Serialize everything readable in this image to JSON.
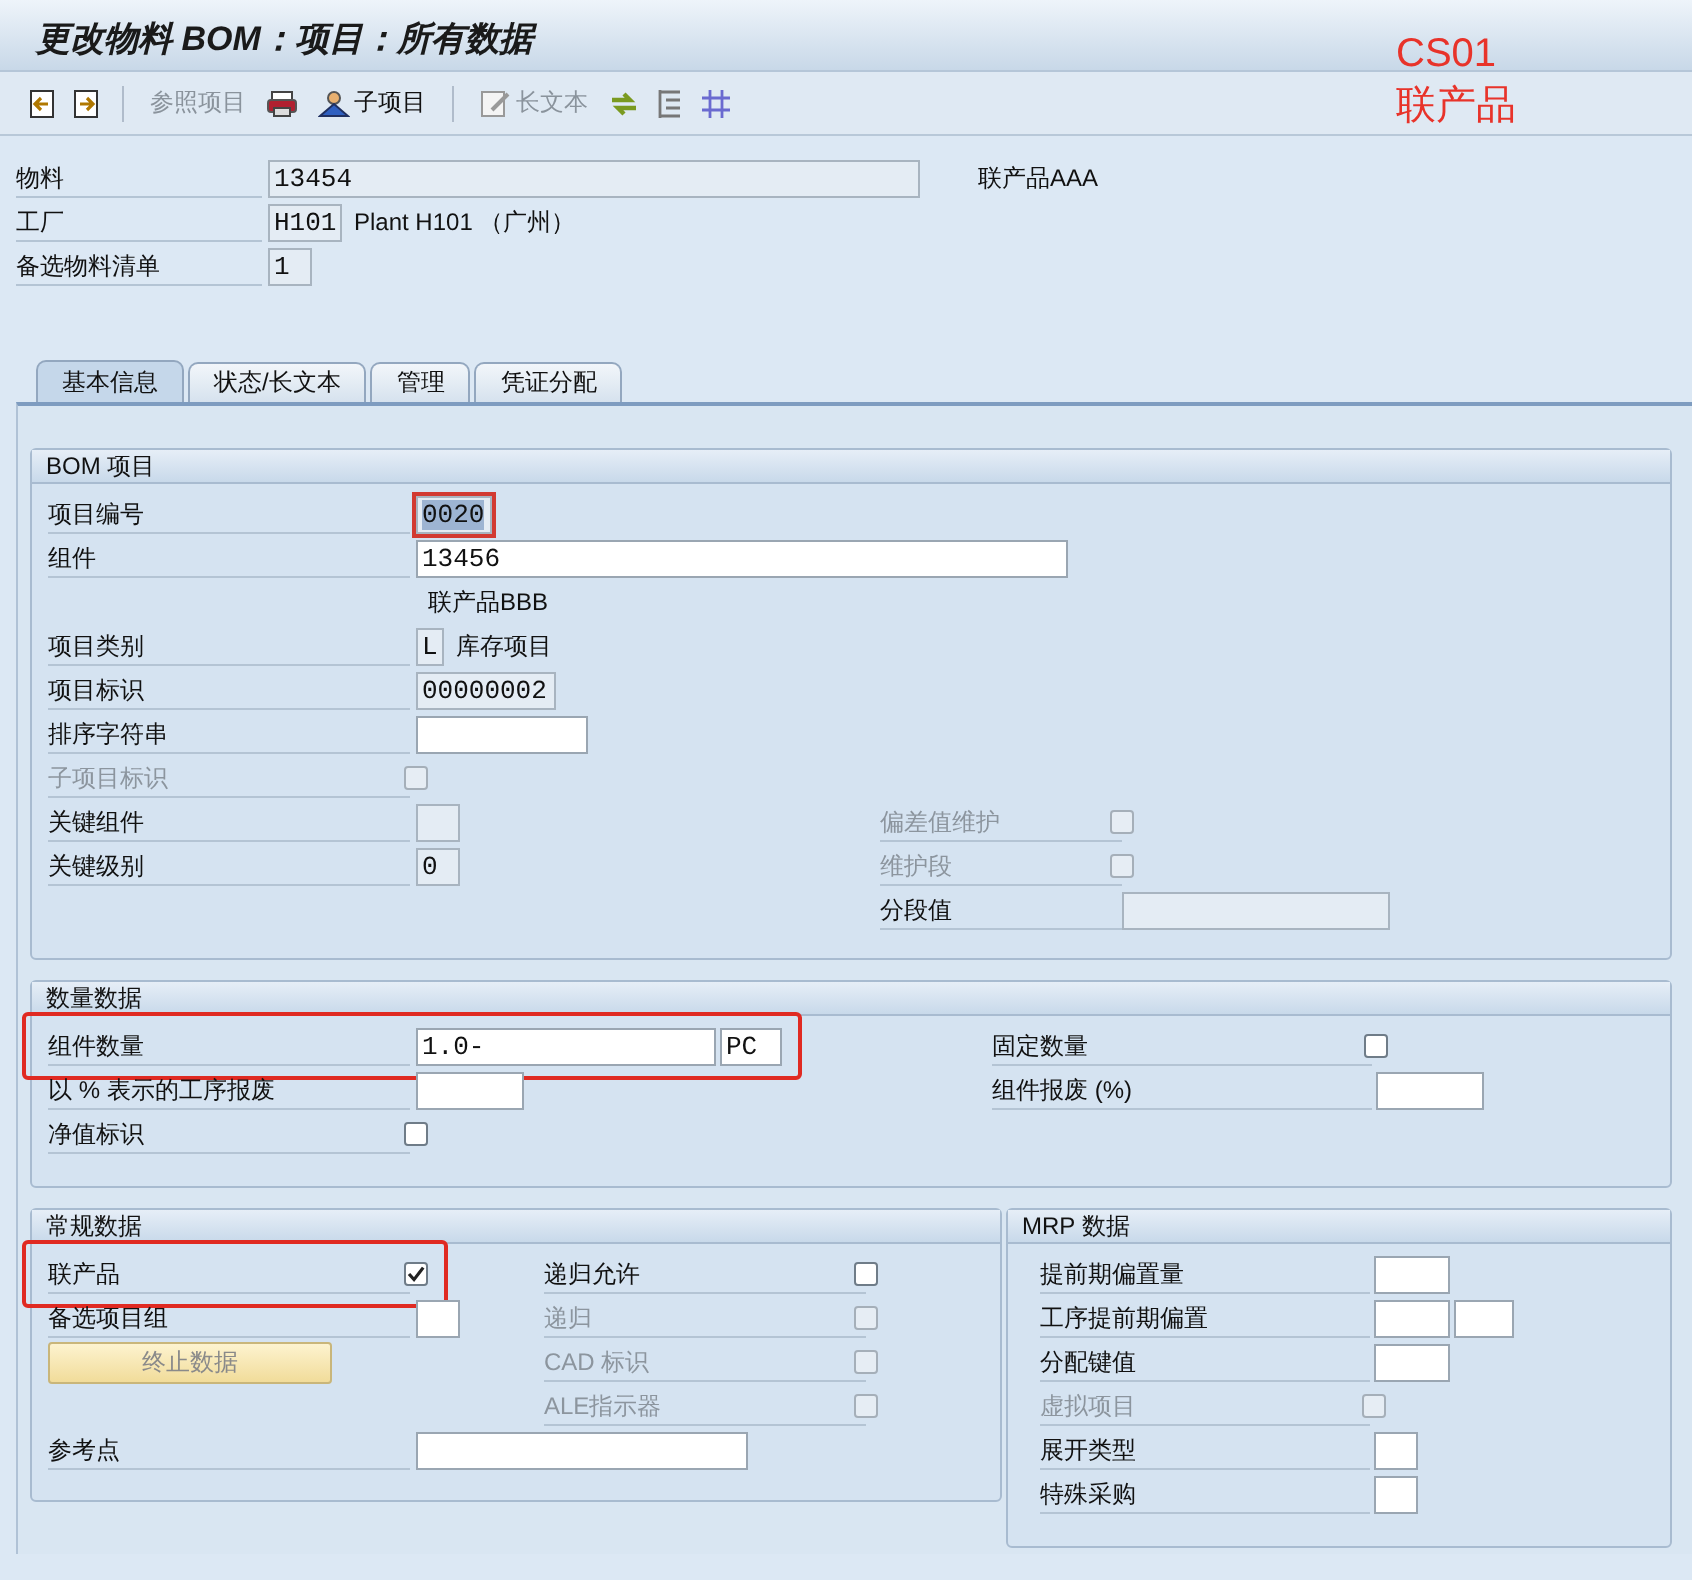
{
  "window": {
    "title": "更改物料 BOM：项目：所有数据"
  },
  "annotation": {
    "lines": [
      "CS01",
      "联产品"
    ]
  },
  "toolbar": [
    {
      "label": "参照项目",
      "disabled": true
    },
    {
      "label": "子项目",
      "disabled": false
    },
    {
      "label": "长文本",
      "disabled": true
    }
  ],
  "header_fields": [
    {
      "label": "物料",
      "controls": [
        {
          "kind": "field",
          "value": "13454",
          "disabled": true
        },
        {
          "kind": "text",
          "text": "联产品AAA"
        }
      ]
    },
    {
      "label": "工厂",
      "controls": [
        {
          "kind": "field",
          "value": "H101",
          "disabled": true
        },
        {
          "kind": "text",
          "text": "Plant H101 （广州）"
        }
      ]
    },
    {
      "label": "备选物料清单",
      "controls": [
        {
          "kind": "field",
          "value": "1",
          "disabled": true
        }
      ]
    }
  ],
  "tabs": [
    {
      "label": "基本信息",
      "selected": true
    },
    {
      "label": "状态/长文本",
      "selected": false
    },
    {
      "label": "管理",
      "selected": false
    },
    {
      "label": "凭证分配",
      "selected": false
    }
  ],
  "groups": [
    {
      "title": "BOM 项目",
      "rows": [
        {
          "left": {
            "label": "项目编号",
            "disabled": false,
            "controls": [
              {
                "kind": "field",
                "value": "0020",
                "disabled": true,
                "focused": true
              }
            ]
          }
        },
        {
          "left": {
            "label": "组件",
            "disabled": false,
            "controls": [
              {
                "kind": "field",
                "value": "13456",
                "disabled": false,
                "focused": false
              }
            ]
          }
        },
        {
          "left": {
            "controls": [
              {
                "kind": "text",
                "text": "联产品BBB"
              }
            ]
          }
        },
        {
          "left": {
            "label": "项目类别",
            "disabled": false,
            "controls": [
              {
                "kind": "field",
                "value": "L",
                "disabled": true,
                "focused": false
              },
              {
                "kind": "text",
                "text": "库存项目"
              }
            ]
          }
        },
        {
          "left": {
            "label": "项目标识",
            "disabled": false,
            "controls": [
              {
                "kind": "field",
                "value": "00000002",
                "disabled": true,
                "focused": false
              }
            ]
          }
        },
        {
          "left": {
            "label": "排序字符串",
            "disabled": false,
            "controls": [
              {
                "kind": "field",
                "disabled": false,
                "focused": false
              }
            ]
          }
        },
        {
          "left": {
            "label": "子项目标识",
            "disabled": true,
            "controls": [
              {
                "kind": "checkbox",
                "checked": false,
                "disabled": true
              }
            ]
          }
        },
        {
          "left": {
            "label": "关键组件",
            "disabled": false,
            "controls": [
              {
                "kind": "field",
                "disabled": true,
                "focused": false
              }
            ]
          },
          "right": {
            "label": "偏差值维护",
            "disabled": true,
            "controls": [
              {
                "kind": "checkbox",
                "checked": false,
                "disabled": true
              }
            ]
          }
        },
        {
          "left": {
            "label": "关键级别",
            "disabled": false,
            "controls": [
              {
                "kind": "field",
                "value": "0",
                "disabled": true,
                "focused": false
              }
            ]
          },
          "right": {
            "label": "维护段",
            "disabled": true,
            "controls": [
              {
                "kind": "checkbox",
                "checked": false,
                "disabled": true
              }
            ]
          }
        },
        {
          "right": {
            "label": "分段值",
            "disabled": false,
            "controls": [
              {
                "kind": "field",
                "disabled": true,
                "focused": false
              }
            ]
          }
        }
      ]
    },
    {
      "title": "数量数据",
      "rows": [
        {
          "left": {
            "label": "组件数量",
            "disabled": false,
            "highlighted": true,
            "controls": [
              {
                "kind": "field",
                "value": "1.0-",
                "disabled": false,
                "focused": false
              },
              {
                "kind": "field",
                "value": "PC",
                "disabled": false,
                "focused": false
              }
            ]
          },
          "right": {
            "label": "固定数量",
            "disabled": false,
            "controls": [
              {
                "kind": "checkbox",
                "checked": false,
                "disabled": false
              }
            ]
          }
        },
        {
          "left": {
            "label": "以 % 表示的工序报废",
            "disabled": false,
            "controls": [
              {
                "kind": "field",
                "disabled": false,
                "focused": false
              }
            ]
          },
          "right": {
            "label": "组件报废 (%)",
            "disabled": false,
            "controls": [
              {
                "kind": "field",
                "disabled": false,
                "focused": false
              }
            ]
          }
        },
        {
          "left": {
            "label": "净值标识",
            "disabled": false,
            "controls": [
              {
                "kind": "checkbox",
                "checked": false,
                "disabled": false
              }
            ]
          }
        }
      ]
    },
    {
      "title": "常规数据",
      "rows": [
        {
          "left": {
            "label": "联产品",
            "disabled": false,
            "highlighted": true,
            "controls": [
              {
                "kind": "checkbox",
                "checked": true,
                "disabled": false
              }
            ]
          },
          "right": {
            "label": "递归允许",
            "disabled": false,
            "controls": [
              {
                "kind": "checkbox",
                "checked": false,
                "disabled": false
              }
            ]
          }
        },
        {
          "left": {
            "label": "备选项目组",
            "disabled": false,
            "controls": [
              {
                "kind": "field",
                "disabled": false,
                "focused": false
              }
            ]
          },
          "right": {
            "label": "递归",
            "disabled": true,
            "controls": [
              {
                "kind": "checkbox",
                "checked": false,
                "disabled": true
              }
            ]
          }
        },
        {
          "left": {
            "controls": [
              {
                "kind": "button",
                "label": "终止数据",
                "disabled": true
              }
            ]
          },
          "right": {
            "label": "CAD 标识",
            "disabled": true,
            "controls": [
              {
                "kind": "checkbox",
                "checked": false,
                "disabled": true
              }
            ]
          }
        },
        {
          "right": {
            "label": "ALE指示器",
            "disabled": true,
            "controls": [
              {
                "kind": "checkbox",
                "checked": false,
                "disabled": true
              }
            ]
          }
        },
        {
          "left": {
            "label": "参考点",
            "disabled": false,
            "controls": [
              {
                "kind": "field",
                "disabled": false,
                "focused": false
              }
            ]
          }
        }
      ]
    },
    {
      "title": "MRP 数据",
      "rows": [
        {
          "left": {
            "label": "提前期偏置量",
            "disabled": false,
            "controls": [
              {
                "kind": "field",
                "disabled": false,
                "focused": false
              }
            ]
          }
        },
        {
          "left": {
            "label": "工序提前期偏置",
            "disabled": false,
            "controls": [
              {
                "kind": "field",
                "disabled": false,
                "focused": false
              },
              {
                "kind": "field",
                "disabled": false,
                "focused": false
              }
            ]
          }
        },
        {
          "left": {
            "label": "分配键值",
            "disabled": false,
            "controls": [
              {
                "kind": "field",
                "disabled": false,
                "focused": false
              }
            ]
          }
        },
        {
          "left": {
            "label": "虚拟项目",
            "disabled": true,
            "controls": [
              {
                "kind": "checkbox",
                "checked": false,
                "disabled": true
              }
            ]
          }
        },
        {
          "left": {
            "label": "展开类型",
            "disabled": false,
            "controls": [
              {
                "kind": "field",
                "disabled": false,
                "focused": false
              }
            ]
          }
        },
        {
          "left": {
            "label": "特殊采购",
            "disabled": false,
            "controls": [
              {
                "kind": "field",
                "disabled": false,
                "focused": false
              }
            ]
          }
        }
      ]
    }
  ]
}
